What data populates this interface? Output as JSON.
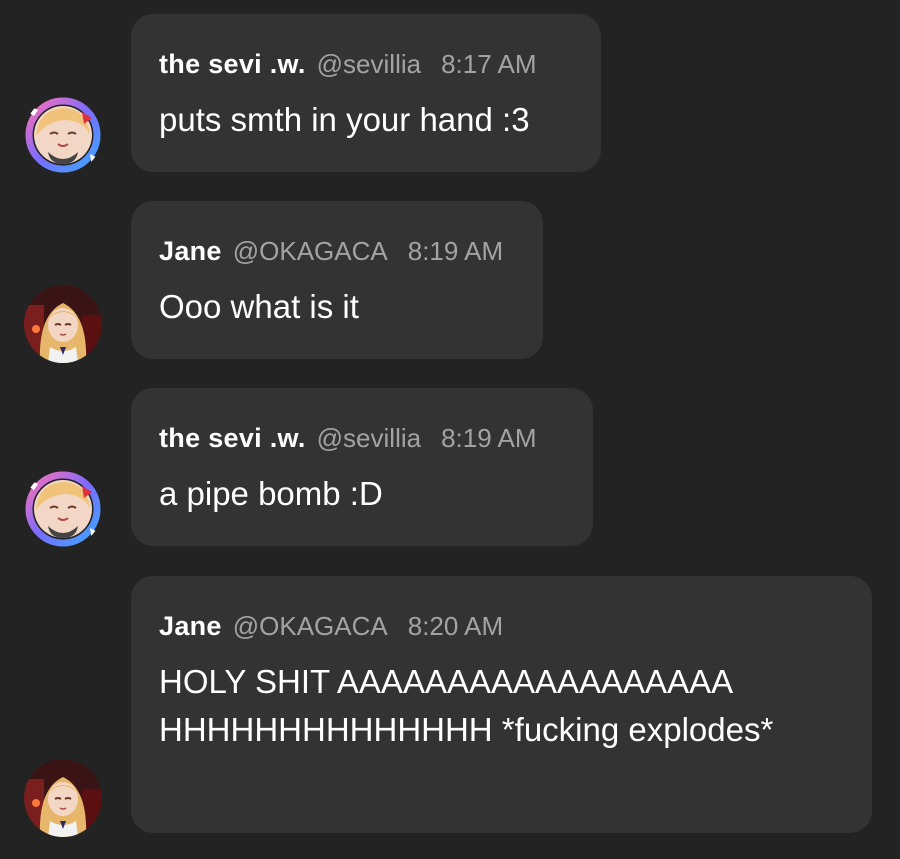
{
  "messages": [
    {
      "author": "the sevi .w.",
      "handle": "@sevillia",
      "time": "8:17 AM",
      "text": "puts smth in your hand :3",
      "avatar_icon": "anime-girl-avatar-icon"
    },
    {
      "author": "Jane",
      "handle": "@OKAGACA",
      "time": "8:19 AM",
      "text": "Ooo what is it",
      "avatar_icon": "anime-girl-avatar-icon"
    },
    {
      "author": "the sevi .w.",
      "handle": "@sevillia",
      "time": "8:19 AM",
      "text": "a pipe bomb :D",
      "avatar_icon": "anime-girl-avatar-icon"
    },
    {
      "author": "Jane",
      "handle": "@OKAGACA",
      "time": "8:20 AM",
      "text": "HOLY SHIT AAAAAAAAAAAAAAAAAA HHHHHHHHHHHHHH *fucking explodes*",
      "avatar_icon": "anime-girl-avatar-icon"
    }
  ],
  "colors": {
    "background": "#232323",
    "bubble": "#333333",
    "name": "#ffffff",
    "meta": "#a3a3a3",
    "text": "#ffffff"
  }
}
